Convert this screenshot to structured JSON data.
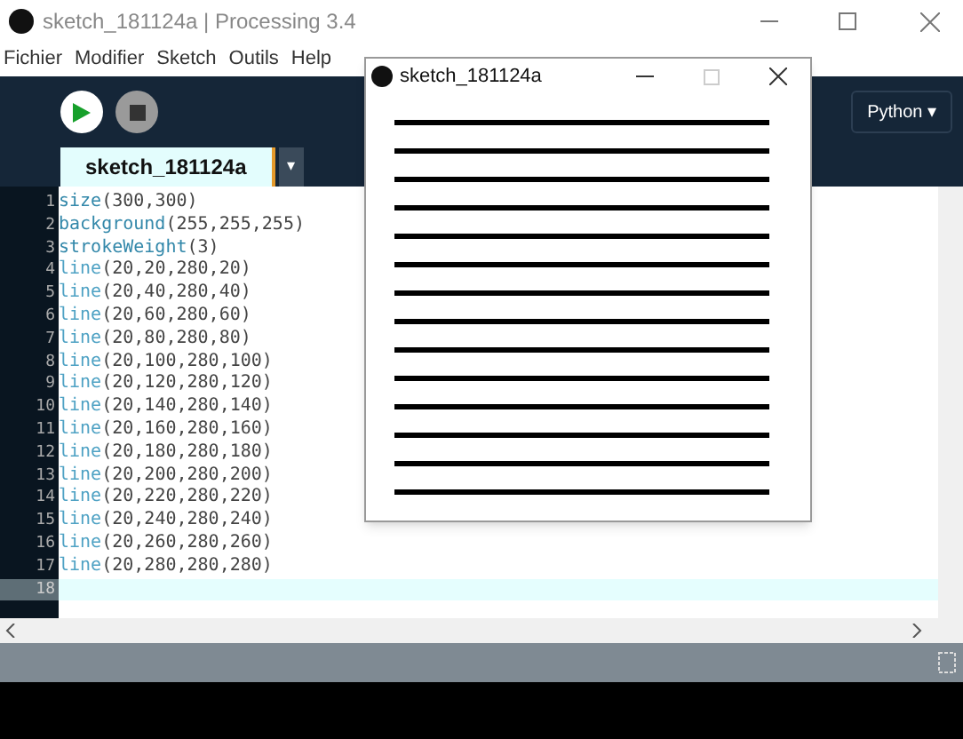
{
  "window": {
    "title": "sketch_181124a | Processing 3.4"
  },
  "menu": [
    "Fichier",
    "Modifier",
    "Sketch",
    "Outils",
    "Help"
  ],
  "toolbar": {
    "mode": "Python ▾"
  },
  "tabs": [
    {
      "label": "sketch_181124a",
      "selected": true
    }
  ],
  "tab_menu": "▾",
  "editor": {
    "lines": [
      {
        "number": "1",
        "fn": "size",
        "args": "(300,300)",
        "current": false
      },
      {
        "number": "2",
        "fn": "background",
        "args": "(255,255,255)",
        "current": false
      },
      {
        "number": "3",
        "fn": "strokeWeight",
        "args": "(3)",
        "current": false
      },
      {
        "number": "4",
        "fn": "line",
        "args": "(20,20,280,20)",
        "current": false
      },
      {
        "number": "5",
        "fn": "line",
        "args": "(20,40,280,40)",
        "current": false
      },
      {
        "number": "6",
        "fn": "line",
        "args": "(20,60,280,60)",
        "current": false
      },
      {
        "number": "7",
        "fn": "line",
        "args": "(20,80,280,80)",
        "current": false
      },
      {
        "number": "8",
        "fn": "line",
        "args": "(20,100,280,100)",
        "current": false
      },
      {
        "number": "9",
        "fn": "line",
        "args": "(20,120,280,120)",
        "current": false
      },
      {
        "number": "10",
        "fn": "line",
        "args": "(20,140,280,140)",
        "current": false
      },
      {
        "number": "11",
        "fn": "line",
        "args": "(20,160,280,160)",
        "current": false
      },
      {
        "number": "12",
        "fn": "line",
        "args": "(20,180,280,180)",
        "current": false
      },
      {
        "number": "13",
        "fn": "line",
        "args": "(20,200,280,200)",
        "current": false
      },
      {
        "number": "14",
        "fn": "line",
        "args": "(20,220,280,220)",
        "current": false
      },
      {
        "number": "15",
        "fn": "line",
        "args": "(20,240,280,240)",
        "current": false
      },
      {
        "number": "16",
        "fn": "line",
        "args": "(20,260,280,260)",
        "current": false
      },
      {
        "number": "17",
        "fn": "line",
        "args": "(20,280,280,280)",
        "current": false
      },
      {
        "number": "18",
        "current": true
      }
    ]
  },
  "sketch_window": {
    "title": "sketch_181124a"
  }
}
